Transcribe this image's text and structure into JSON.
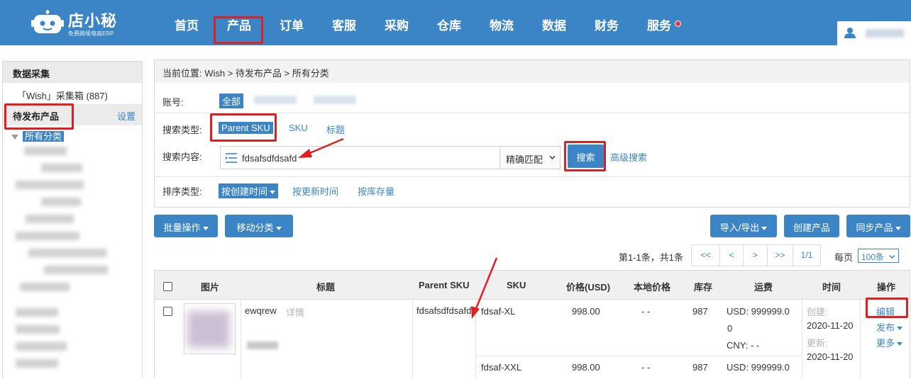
{
  "brand": {
    "name": "店小秘",
    "tagline": "免费跨境电商ERP"
  },
  "nav": {
    "items": [
      {
        "label": "首页"
      },
      {
        "label": "产品"
      },
      {
        "label": "订单"
      },
      {
        "label": "客服"
      },
      {
        "label": "采购"
      },
      {
        "label": "仓库"
      },
      {
        "label": "物流"
      },
      {
        "label": "数据"
      },
      {
        "label": "财务"
      },
      {
        "label": "服务"
      }
    ],
    "active": "产品"
  },
  "sidebar": {
    "section1": "数据采集",
    "collect_box": "「Wish」采集箱 (887)",
    "section2": "待发布产品",
    "settings": "设置",
    "tree_root": "所有分类"
  },
  "filters": {
    "breadcrumb": "当前位置:  Wish > 待发布产品 > 所有分类",
    "account_label": "账号:",
    "account_all": "全部",
    "search_type_label": "搜索类型:",
    "search_types": [
      "Parent SKU",
      "SKU",
      "标题"
    ],
    "search_content_label": "搜索内容:",
    "search_value": "fdsafsdfdsafd",
    "match_mode": "精确匹配",
    "search_button": "搜索",
    "advanced_search": "高级搜索",
    "sort_label": "排序类型:",
    "sort_options": [
      "按创建时间",
      "按更新时间",
      "按库存量"
    ]
  },
  "toolbar": {
    "batch": "批量操作",
    "move": "移动分类",
    "import_export": "导入/导出",
    "create": "创建产品",
    "sync": "同步产品"
  },
  "pagination": {
    "info": "第1-1条，共1条",
    "first": "<<",
    "prev": "<",
    "next": ">",
    "last": ">>",
    "page": "1/1",
    "per_page_label": "每页",
    "per_page_value": "100条"
  },
  "table": {
    "headers": {
      "image": "图片",
      "title": "标题",
      "parent_sku": "Parent SKU",
      "sku": "SKU",
      "price": "价格(USD)",
      "local_price": "本地价格",
      "stock": "库存",
      "shipping": "运费",
      "time": "时间",
      "ops": "操作"
    },
    "row": {
      "title": "ewqrew",
      "detail": "详情",
      "parent_sku": "fdsafsdfdsafd",
      "variants": [
        {
          "sku": "fdsaf-XL",
          "price": "998.00",
          "local": "- -",
          "stock": "987",
          "ship_usd": "USD:  999999.0",
          "ship_usd_cont": "0",
          "ship_cny": "CNY:  - -"
        },
        {
          "sku": "fdsaf-XXL",
          "price": "998.00",
          "local": "- -",
          "stock": "987",
          "ship_usd": "USD:  999999.0"
        }
      ],
      "created_label": "创建:",
      "created": "2020-11-20",
      "updated_label": "更新:",
      "updated": "2020-11-20",
      "ops": {
        "edit": "编辑",
        "publish": "发布",
        "more": "更多"
      }
    }
  },
  "colors": {
    "primary": "#3b85c6",
    "highlight": "#e02020"
  }
}
